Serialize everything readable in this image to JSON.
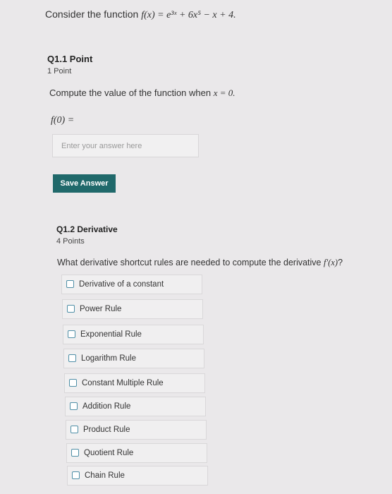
{
  "intro": {
    "text": "Consider the function",
    "formula": "f(x) = e³ˣ + 6x⁵ − x + 4."
  },
  "q1": {
    "title": "Q1.1 Point",
    "points": "1 Point",
    "prompt_text": "Compute the value of the function when",
    "prompt_math": "x = 0.",
    "answer_label": "f(0) =",
    "input_placeholder": "Enter your answer here",
    "input_value": "",
    "save_label": "Save Answer"
  },
  "q2": {
    "title": "Q1.2 Derivative",
    "points": "4 Points",
    "prompt_text": "What derivative shortcut rules are needed to compute the derivative",
    "prompt_math": "f′(x)",
    "prompt_end": "?",
    "options": [
      {
        "label": "Derivative of a constant",
        "checked": false
      },
      {
        "label": "Power Rule",
        "checked": false
      },
      {
        "label": "Exponential Rule",
        "checked": false
      },
      {
        "label": "Logarithm Rule",
        "checked": false
      },
      {
        "label": "Constant Multiple Rule",
        "checked": false
      },
      {
        "label": "Addition Rule",
        "checked": false
      },
      {
        "label": "Product Rule",
        "checked": false
      },
      {
        "label": "Quotient Rule",
        "checked": false
      },
      {
        "label": "Chain Rule",
        "checked": false
      }
    ]
  },
  "colors": {
    "save_button": "#20696b",
    "checkbox_border": "#4f8fa7",
    "background": "#eae8ea"
  }
}
